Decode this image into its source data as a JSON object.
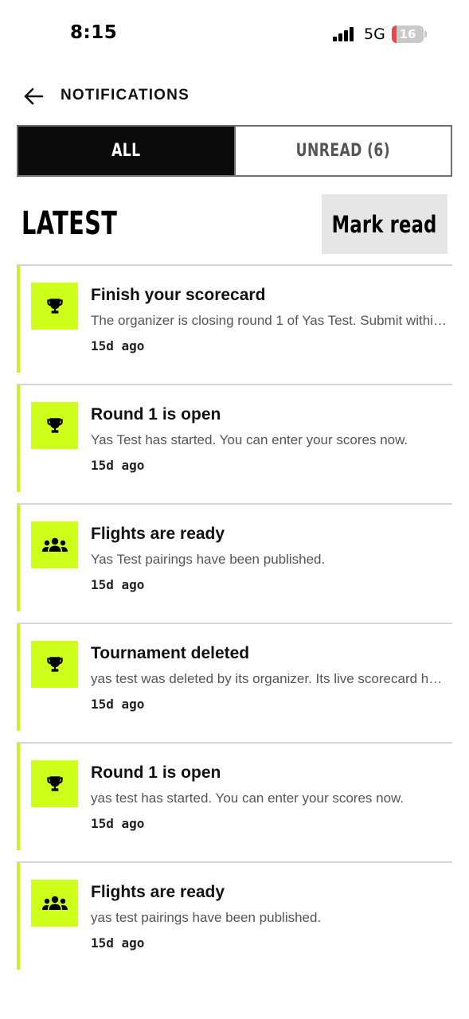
{
  "status_bar": {
    "time": "8:15",
    "network": "5G",
    "battery_level": "16",
    "battery_fraction": 0.16
  },
  "header": {
    "title": "NOTIFICATIONS",
    "back_icon": "arrow-left-icon"
  },
  "tabs": [
    {
      "label": "ALL",
      "active": true
    },
    {
      "label": "UNREAD (6)",
      "active": false
    }
  ],
  "section": {
    "title": "LATEST",
    "mark_read_label": "Mark read"
  },
  "colors": {
    "accent": "#cdff1a",
    "active_tab": "#0b0b0b",
    "battery_low": "#e5484d"
  },
  "notifications": [
    {
      "icon": "trophy-icon",
      "title": "Finish your scorecard",
      "body": "The organizer is closing round 1 of Yas Test. Submit within...",
      "time": "15d ago"
    },
    {
      "icon": "trophy-icon",
      "title": "Round 1 is open",
      "body": "Yas Test has started. You can enter your scores now.",
      "time": "15d ago"
    },
    {
      "icon": "group-icon",
      "title": "Flights are ready",
      "body": "Yas Test pairings have been published.",
      "time": "15d ago"
    },
    {
      "icon": "trophy-icon",
      "title": "Tournament deleted",
      "body": "yas test was deleted by its organizer. Its live scorecard has...",
      "time": "15d ago"
    },
    {
      "icon": "trophy-icon",
      "title": "Round 1 is open",
      "body": "yas test has started. You can enter your scores now.",
      "time": "15d ago"
    },
    {
      "icon": "group-icon",
      "title": "Flights are ready",
      "body": "yas test pairings have been published.",
      "time": "15d ago"
    }
  ]
}
